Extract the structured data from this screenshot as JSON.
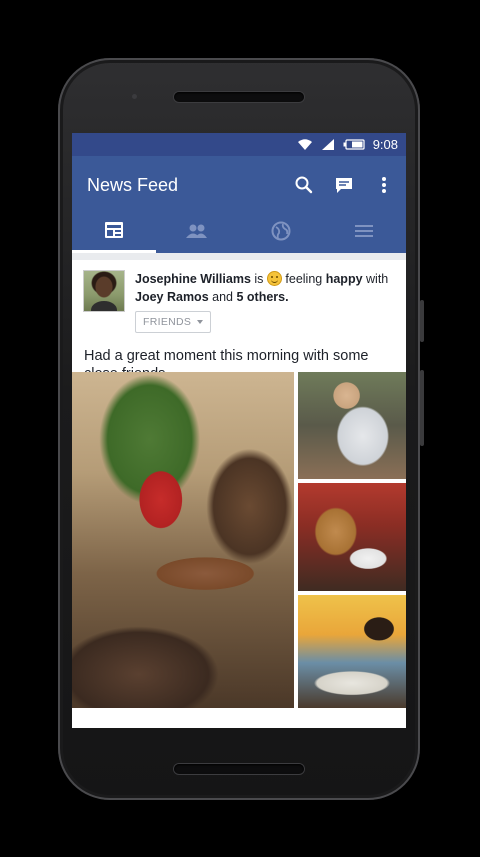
{
  "status_bar": {
    "time": "9:08",
    "icons": [
      "wifi-icon",
      "signal-icon",
      "battery-icon"
    ]
  },
  "app_bar": {
    "title": "News Feed",
    "actions": [
      "search-icon",
      "messenger-icon",
      "overflow-menu-icon"
    ]
  },
  "tabs": [
    {
      "name": "news-feed",
      "icon": "news-feed-icon",
      "active": true
    },
    {
      "name": "friends",
      "icon": "friends-icon",
      "active": false
    },
    {
      "name": "notifications",
      "icon": "globe-icon",
      "active": false
    },
    {
      "name": "menu",
      "icon": "hamburger-icon",
      "active": false
    }
  ],
  "post": {
    "author": "Josephine Williams",
    "is": "is",
    "feeling_prefix": "feeling",
    "feeling": "happy",
    "with": "with",
    "tagged": "Joey Ramos",
    "and": "and",
    "others": "5 others.",
    "audience": "FRIENDS",
    "text": "Had a great moment this morning with some close friends",
    "photos": 4
  },
  "colors": {
    "brand": "#3b5998",
    "status_bar": "#33498a",
    "background": "#e9ebee"
  }
}
